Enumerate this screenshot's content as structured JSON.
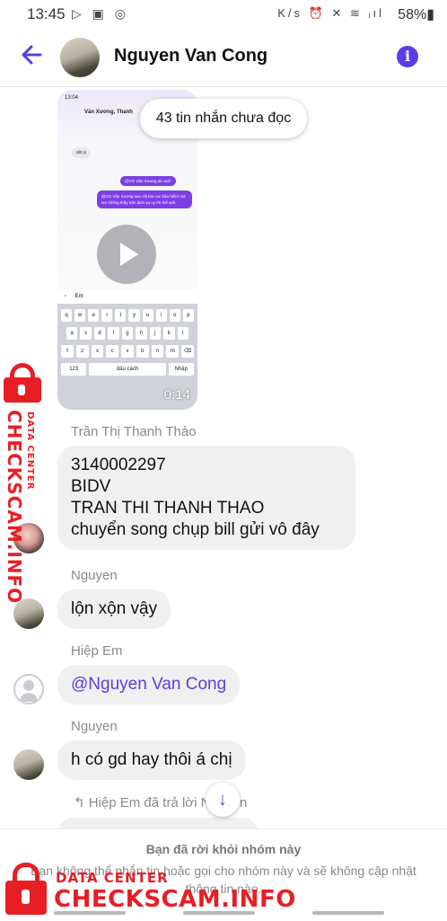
{
  "status_bar": {
    "time": "13:45",
    "left_icons": "▷ ▣ ◎",
    "right_icons": "K/s ⏰ ✕ ≋ ᵢıl",
    "battery": "58%▮"
  },
  "header": {
    "title": "Nguyen Van Cong",
    "back_icon": "arrow-left-icon",
    "info_icon": "info-icon",
    "accent_color": "#5b3de4"
  },
  "video_message": {
    "duration": "0:14",
    "inner_screenshot": {
      "time": "13:04",
      "names": "Văn Xương, Thanh",
      "bubble_1": "@VG Văn Xương alo anh",
      "bubble_2": "@VG Văn Xương sao chị kia cọc bảo hiểm mà em không thấy trên dịch vụ uy tín thế anh",
      "gray_1": "alo ạ",
      "input_text": "Em",
      "keys_row1": [
        "q",
        "w",
        "e",
        "r",
        "t",
        "y",
        "u",
        "i",
        "o",
        "p"
      ],
      "keys_row2": [
        "a",
        "s",
        "d",
        "f",
        "g",
        "h",
        "j",
        "k",
        "l"
      ],
      "keys_row3": [
        "⇧",
        "z",
        "x",
        "c",
        "v",
        "b",
        "n",
        "m",
        "⌫"
      ],
      "keys_row4": [
        "123",
        "dấu cách",
        "Nhập"
      ]
    }
  },
  "unread_toast": "43 tin nhắn chưa đọc",
  "messages": [
    {
      "sender": "Trần Thị Thanh Thảo",
      "lines": [
        "3140002297",
        "BIDV",
        "TRAN THI THANH THAO",
        "chuyển song chụp bill gửi vô đây"
      ]
    },
    {
      "sender": "Nguyen",
      "text": "lộn xộn vậy"
    },
    {
      "sender": "Hiệp Em",
      "text": "@Nguyen Van Cong"
    },
    {
      "sender": "Nguyen",
      "text": "h có gd hay thôi á chị"
    }
  ],
  "reply_note": "↰ Hiệp Em đã trả lời Nguyen",
  "scroll_down_icon": "arrow-down-icon",
  "footer": {
    "title": "Bạn đã rời khỏi nhóm này",
    "description": "Bạn không thể nhắn tin hoặc gọi cho nhóm này và sẽ không cập nhật thông tin nào."
  },
  "watermark": {
    "line1": "DATA CENTER",
    "line2": "CHECKSCAM.INFO",
    "color": "#e81e25"
  }
}
